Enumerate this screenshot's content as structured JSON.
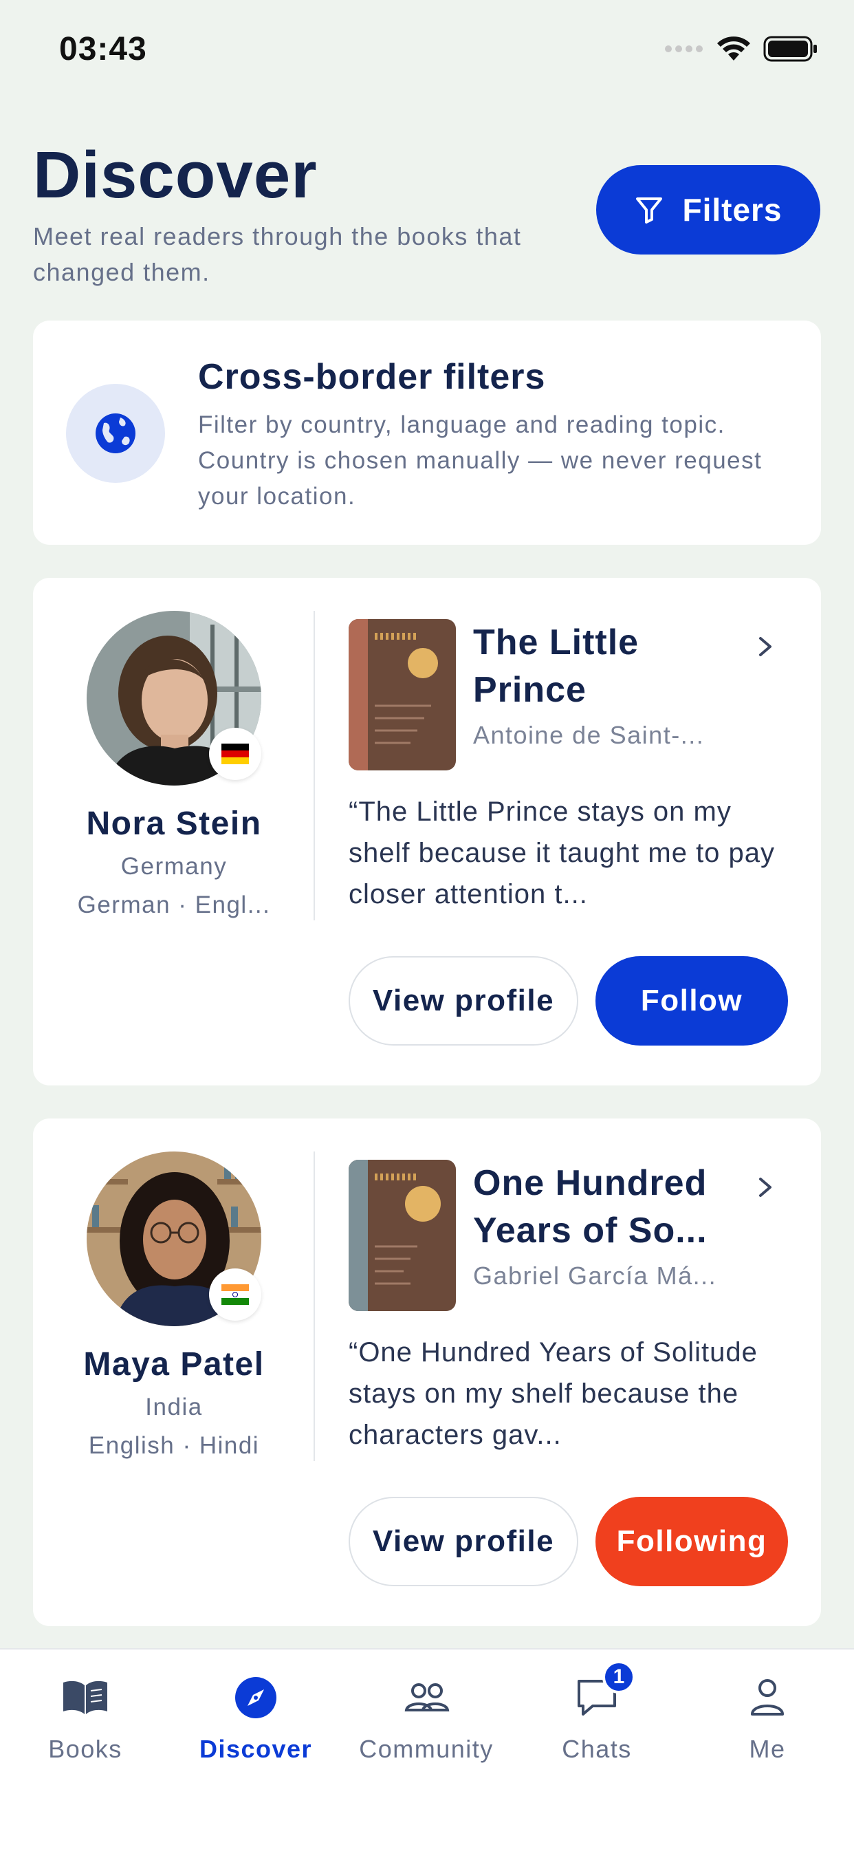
{
  "status_bar": {
    "time": "03:43"
  },
  "header": {
    "title": "Discover",
    "subtitle": "Meet real readers through the books that changed them.",
    "filters_label": "Filters"
  },
  "info_card": {
    "title": "Cross-border filters",
    "text": "Filter by country, language and reading topic. Country is chosen manually — we never request your location.",
    "icon": "globe-icon"
  },
  "readers": [
    {
      "name": "Nora Stein",
      "country": "Germany",
      "languages": "German · Engl...",
      "flag": "germany-flag",
      "book_title": "The Little Prince",
      "book_author": "Antoine de Saint-...",
      "quote": "“The Little Prince stays on my shelf because it taught me to pay closer attention t...",
      "view_label": "View profile",
      "follow_label": "Follow",
      "following": false
    },
    {
      "name": "Maya Patel",
      "country": "India",
      "languages": "English · Hindi",
      "flag": "india-flag",
      "book_title": "One Hundred Years of So...",
      "book_author": "Gabriel García Má...",
      "quote": "“One Hundred Years of Solitude stays on my shelf because the characters gav...",
      "view_label": "View profile",
      "follow_label": "Following",
      "following": true
    }
  ],
  "tabs": [
    {
      "label": "Books",
      "icon": "book-icon",
      "active": false
    },
    {
      "label": "Discover",
      "icon": "compass-icon",
      "active": true
    },
    {
      "label": "Community",
      "icon": "people-icon",
      "active": false
    },
    {
      "label": "Chats",
      "icon": "chat-icon",
      "active": false,
      "badge": "1"
    },
    {
      "label": "Me",
      "icon": "person-icon",
      "active": false
    }
  ],
  "colors": {
    "accent": "#0b3bd6",
    "following": "#f0401e",
    "background": "#eef3ee"
  }
}
